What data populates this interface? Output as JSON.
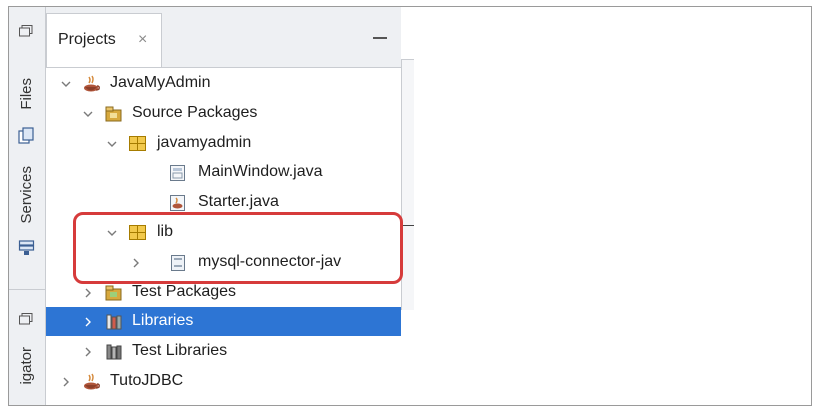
{
  "side_tabs": {
    "files": "Files",
    "services": "Services",
    "navigator": "igator"
  },
  "projects_tab": {
    "label": "Projects",
    "close": "×"
  },
  "tree": [
    {
      "label": "JavaMyAdmin",
      "level": 0,
      "expanded": true,
      "icon": "java-project-icon"
    },
    {
      "label": "Source Packages",
      "level": 1,
      "expanded": true,
      "icon": "source-packages-icon"
    },
    {
      "label": "javamyadmin",
      "level": 2,
      "expanded": true,
      "icon": "package-icon"
    },
    {
      "label": "MainWindow.java",
      "level": 3,
      "icon": "java-form-icon"
    },
    {
      "label": "Starter.java",
      "level": 3,
      "icon": "java-class-icon"
    },
    {
      "label": "lib",
      "level": 2,
      "expanded": true,
      "icon": "package-icon"
    },
    {
      "label": "mysql-connector-jav",
      "level": 3,
      "expanded": false,
      "icon": "jar-icon"
    },
    {
      "label": "Test Packages",
      "level": 1,
      "expanded": false,
      "icon": "test-packages-icon"
    },
    {
      "label": "Libraries",
      "level": 1,
      "expanded": false,
      "icon": "libraries-icon",
      "selected": true
    },
    {
      "label": "Test Libraries",
      "level": 1,
      "expanded": false,
      "icon": "test-libraries-icon"
    },
    {
      "label": "TutoJDBC",
      "level": 0,
      "expanded": false,
      "icon": "java-project-icon"
    }
  ],
  "colors": {
    "selection": "#2d75d4",
    "highlight": "#d63b3b"
  }
}
